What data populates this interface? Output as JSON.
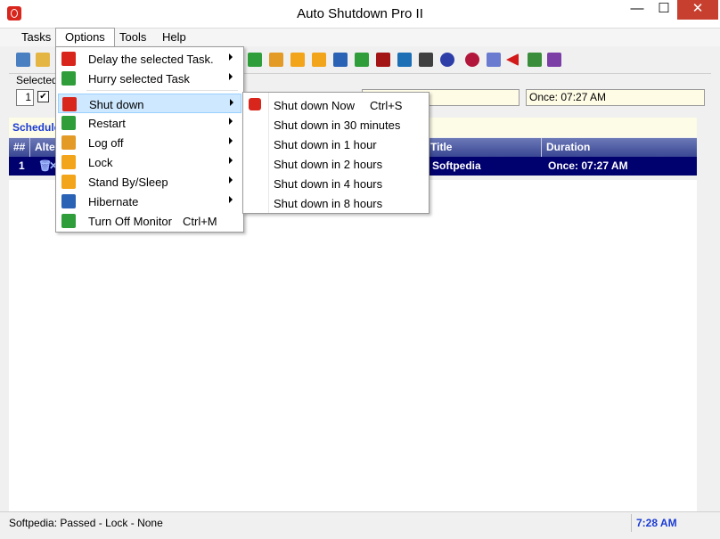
{
  "window": {
    "title": "Auto Shutdown Pro II",
    "min": "—",
    "max": "☐",
    "close": "✕"
  },
  "menubar": {
    "tasks": "Tasks",
    "options": "Options",
    "tools": "Tools",
    "help": "Help"
  },
  "selected": {
    "label": "Selected",
    "number": "1",
    "check": "✔",
    "time_field": "Once: 07:27 AM"
  },
  "schedule": {
    "label": "Schedule"
  },
  "table": {
    "headers": {
      "num": "##",
      "alter": "Alte",
      "title": "Title",
      "duration": "Duration"
    },
    "row": {
      "num": "1",
      "title": "Softpedia",
      "duration": "Once: 07:27 AM"
    }
  },
  "options_menu": {
    "items": [
      {
        "label": "Delay the selected Task.",
        "icon": "delay-icon",
        "color": "#d8261d"
      },
      {
        "label": "Hurry selected Task",
        "icon": "hurry-icon",
        "color": "#2f9e3a"
      },
      {
        "label": "Shut down",
        "icon": "shutdown-icon",
        "color": "#d8261d"
      },
      {
        "label": "Restart",
        "icon": "restart-icon",
        "color": "#2f9e3a"
      },
      {
        "label": "Log off",
        "icon": "logoff-icon",
        "color": "#e39a27"
      },
      {
        "label": "Lock",
        "icon": "lock-icon",
        "color": "#f2a41a"
      },
      {
        "label": "Stand By/Sleep",
        "icon": "sleep-icon",
        "color": "#f2a41a"
      },
      {
        "label": "Hibernate",
        "icon": "hibernate-icon",
        "color": "#2a62b5"
      },
      {
        "label": "Turn Off Monitor",
        "shortcut": "Ctrl+M",
        "icon": "monitor-icon",
        "color": "#2f9e3a"
      }
    ]
  },
  "shutdown_submenu": {
    "items": [
      {
        "label": "Shut down Now",
        "shortcut": "Ctrl+S"
      },
      {
        "label": "Shut down  in 30 minutes"
      },
      {
        "label": "Shut down in 1 hour"
      },
      {
        "label": "Shut down in 2 hours"
      },
      {
        "label": "Shut down in 4 hours"
      },
      {
        "label": "Shut down in 8 hours"
      }
    ]
  },
  "status": {
    "text": "Softpedia:  Passed - Lock - None",
    "time": "7:28 AM"
  }
}
